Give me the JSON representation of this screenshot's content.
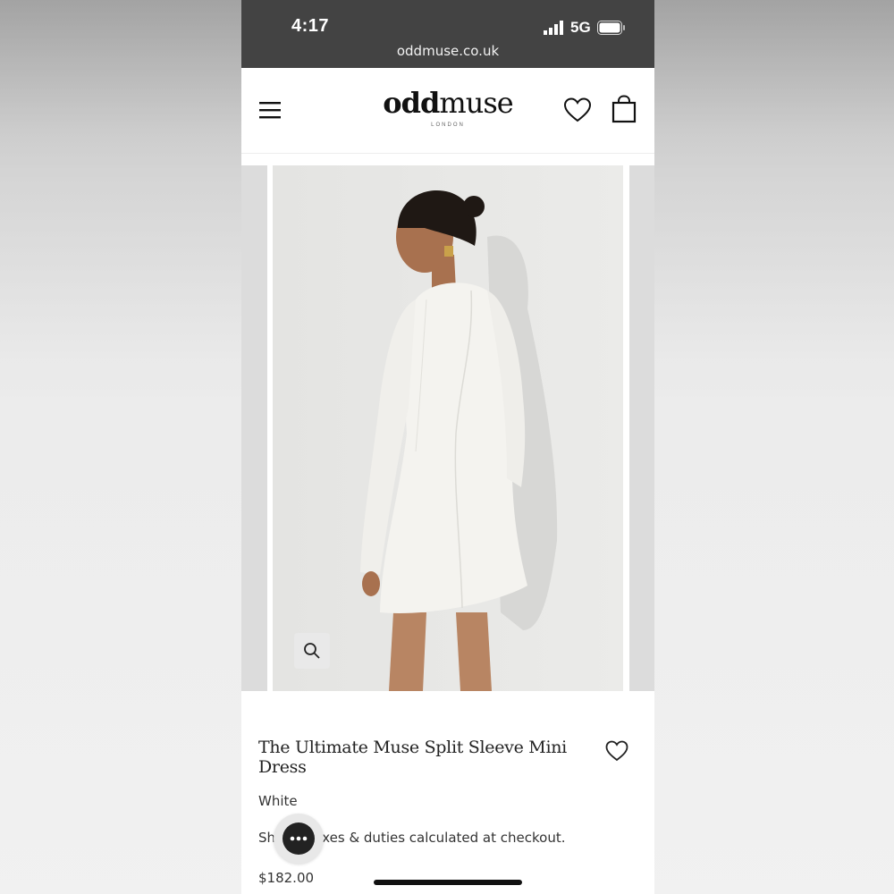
{
  "status_bar": {
    "time": "4:17",
    "network": "5G",
    "url": "oddmuse.co.uk"
  },
  "header": {
    "logo_bold": "odd",
    "logo_regular": "muse",
    "logo_sub": "LONDON"
  },
  "product": {
    "title": "The Ultimate Muse Split Sleeve Mini Dress",
    "color": "White",
    "shipping_prefix": "Sh",
    "shipping_suffix": "axes & duties calculated at checkout.",
    "price": "$182.00"
  },
  "icons": {
    "menu": "hamburger-menu-icon",
    "wishlist": "heart-icon",
    "cart": "shopping-bag-icon",
    "zoom": "magnifier-icon",
    "chat": "chat-bubble-icon"
  },
  "colors": {
    "status_bar": "#434343",
    "text": "#222222",
    "image_background": "#e8e8e6"
  }
}
